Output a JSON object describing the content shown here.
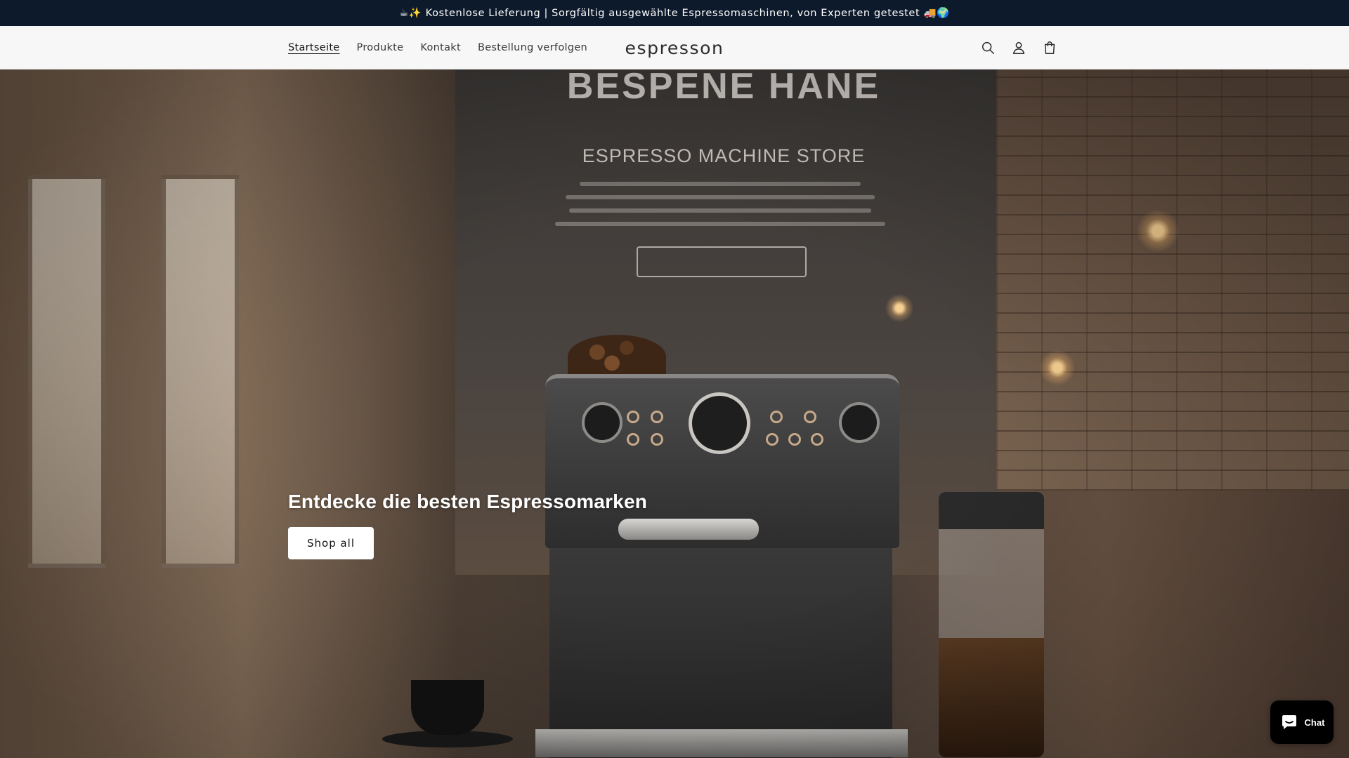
{
  "announcement": {
    "text": "☕✨ Kostenlose Lieferung | Sorgfältig ausgewählte Espressomaschinen, von Experten getestet 🚚🌍"
  },
  "header": {
    "nav": [
      {
        "label": "Startseite",
        "active": true
      },
      {
        "label": "Produkte",
        "active": false
      },
      {
        "label": "Kontakt",
        "active": false
      },
      {
        "label": "Bestellung verfolgen",
        "active": false
      }
    ],
    "logo": "espresson",
    "icons": [
      "search-icon",
      "account-icon",
      "cart-icon"
    ]
  },
  "hero": {
    "sign_title": "BESPENE HANE",
    "sign_subtitle": "ESPRESSO MACHINE STORE",
    "heading": "Entdecke die besten Espressomarken",
    "button_label": "Shop all"
  },
  "chat": {
    "label": "Chat"
  },
  "colors": {
    "announcement_bg": "#0d1a2b",
    "header_bg": "#f7f7f7",
    "button_bg": "#ffffff",
    "chat_bg": "#000000"
  }
}
